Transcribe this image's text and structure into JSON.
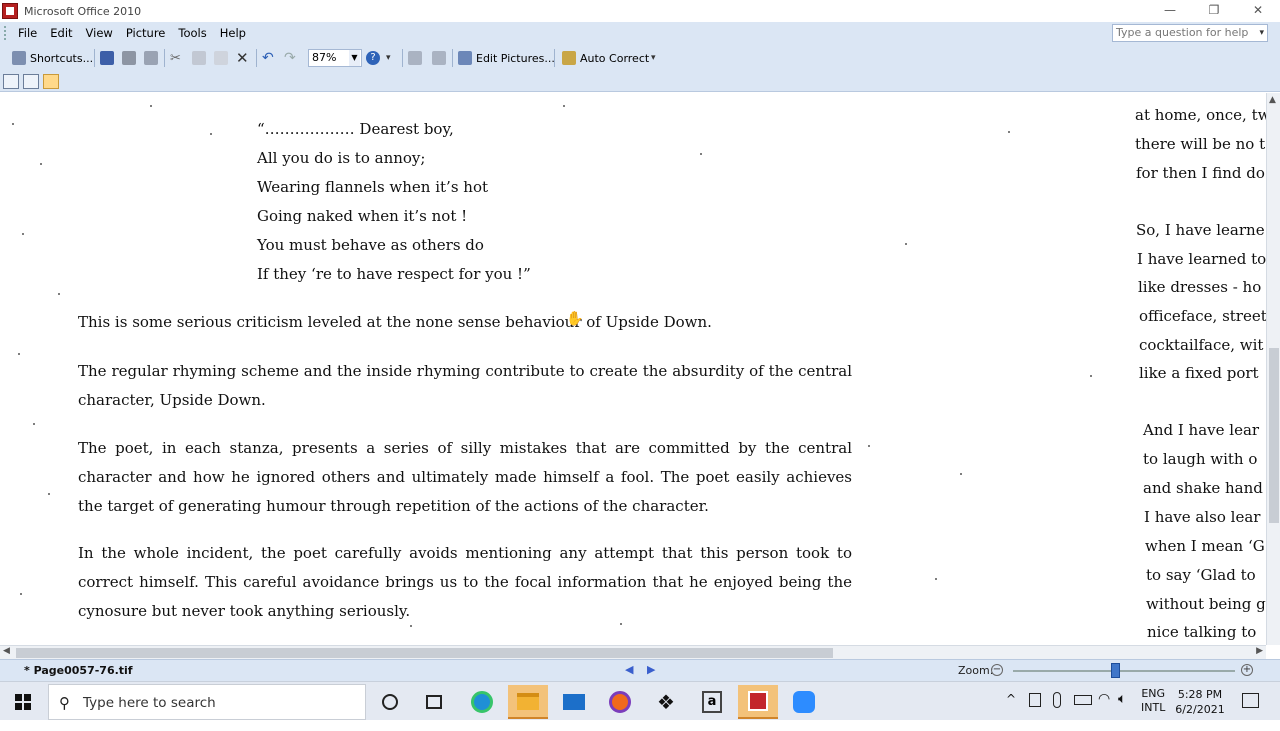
{
  "window": {
    "title": "Microsoft Office 2010",
    "controls": [
      "—",
      "❐",
      "✕"
    ]
  },
  "menu": {
    "items": [
      "File",
      "Edit",
      "View",
      "Picture",
      "Tools",
      "Help"
    ],
    "help_placeholder": "Type a question for help"
  },
  "toolbar": {
    "shortcuts_label": "Shortcuts...",
    "zoom_value": "87%",
    "edit_pictures_label": "Edit Pictures...",
    "auto_correct_label": "Auto Correct"
  },
  "document": {
    "poem": [
      "“……………… Dearest boy,",
      "All you do is to annoy;",
      "Wearing flannels when it’s hot",
      "Going naked when it’s not !",
      "You must behave as others do",
      "If they ‘re to have respect for you !”"
    ],
    "paragraphs": [
      "This is some serious criticism leveled at the none sense behaviour of Upside Down.",
      "The regular rhyming scheme and the inside rhyming contribute to create the absurdity of the central character, Upside Down.",
      "The poet, in each stanza, presents a series of silly mistakes that are committed by the central character and how he ignored others and ultimately made himself a fool. The poet easily achieves the target of generating humour through repetition of the actions of the character.",
      "In the whole incident, the poet carefully avoids mentioning any attempt that this person took to correct himself. This careful avoidance brings us to the focal information that he enjoyed being the cynosure but never took anything seriously."
    ],
    "right_column": [
      "at home, once, tw",
      "there will be no t",
      "for then I find do",
      "So, I have learne",
      "I have learned to",
      "like dresses - ho",
      "officeface, street",
      "cocktailface, wit",
      "like a fixed port",
      "And I have lear",
      "to laugh with o",
      "and shake hand",
      "I have also lear",
      "when I mean ‘G",
      "to say ‘Glad to",
      "without being g",
      "nice talking to"
    ]
  },
  "status": {
    "filename": "* Page0057-76.tif",
    "zoom_label": "Zoom:",
    "zoom_fraction": 0.46
  },
  "taskbar": {
    "search_placeholder": "Type here to search",
    "language_top": "ENG",
    "language_bottom": "INTL",
    "time": "5:28 PM",
    "date": "6/2/2021"
  }
}
